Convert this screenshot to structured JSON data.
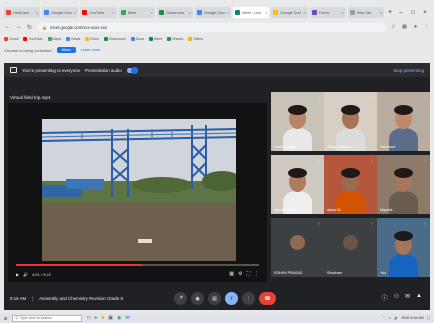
{
  "browser": {
    "tabs": [
      {
        "label": "Hindi test",
        "color": "#ea4335",
        "active": false
      },
      {
        "label": "Google Docs",
        "color": "#4285f4",
        "active": false
      },
      {
        "label": "YouTube",
        "color": "#ff0000",
        "active": false
      },
      {
        "label": "Meet",
        "color": "#34a853",
        "active": false
      },
      {
        "label": "Classroom",
        "color": "#1e8e3e",
        "active": false
      },
      {
        "label": "Google Docs",
        "color": "#4285f4",
        "active": false
      },
      {
        "label": "Meet - Live",
        "color": "#00897b",
        "active": true
      },
      {
        "label": "Google Drive",
        "color": "#fbbc04",
        "active": false
      },
      {
        "label": "Forms",
        "color": "#7248b9",
        "active": false
      },
      {
        "label": "New Tab",
        "color": "#9aa0a6",
        "active": false
      }
    ],
    "url": "meet.google.com/xxx-xxxx-xxx",
    "bookmarks": [
      {
        "label": "Gmail",
        "color": "#ea4335"
      },
      {
        "label": "YouTube",
        "color": "#ff0000"
      },
      {
        "label": "Maps",
        "color": "#34a853"
      },
      {
        "label": "News",
        "color": "#4285f4"
      },
      {
        "label": "Drive",
        "color": "#fbbc04"
      },
      {
        "label": "Classroom",
        "color": "#1e8e3e"
      },
      {
        "label": "Docs",
        "color": "#4285f4"
      },
      {
        "label": "Meet",
        "color": "#00897b"
      },
      {
        "label": "Sheets",
        "color": "#0f9d58"
      },
      {
        "label": "Slides",
        "color": "#f4b400"
      }
    ],
    "infobar": {
      "text": "Chrome is being controlled",
      "button": "Allow",
      "link": "Learn more"
    }
  },
  "meet": {
    "presenting_text": "You're presenting to everyone",
    "presentation_audio": "Presentation audio",
    "stop_presenting": "Stop presenting",
    "file_title": "Virtual field trip.mp4",
    "video_time": "4:51 / 9:22",
    "video_progress": 0.52,
    "participants": [
      {
        "name": "Harshit Singh",
        "skin": "#b88466",
        "shirt": "#e8e8e8",
        "bg": "#c9c2b8"
      },
      {
        "name": "Aditya Sharma",
        "skin": "#a97456",
        "shirt": "#dcdcdc",
        "bg": "#d7cfc4"
      },
      {
        "name": "Vaishnavi",
        "skin": "#c08a6a",
        "shirt": "#5b6b8a",
        "bg": "#b8aca0"
      },
      {
        "name": "Ayesha Ansari",
        "skin": "#b07a5c",
        "shirt": "#eeeeee",
        "bg": "#cfc9c1"
      },
      {
        "name": "Aarav M.",
        "skin": "#9c6a4e",
        "shirt": "#d35400",
        "bg": "#b5563e"
      },
      {
        "name": "Mayank",
        "skin": "#a8765a",
        "shirt": "#6a5d4f",
        "bg": "#8d7a68"
      },
      {
        "name": "ROHINI PRASAD",
        "skin": "#8e6a52",
        "shirt": "#ffffff",
        "bg": "#3c4043"
      },
      {
        "name": "Shubham",
        "skin": "#6b5444",
        "shirt": "#263238",
        "bg": "#3c4043"
      },
      {
        "name": "You",
        "skin": "#a5745a",
        "shirt": "#1565c0",
        "bg": "#4a6b8a"
      }
    ],
    "meeting_time": "9:16 AM",
    "meeting_title": "Assembly and Chemistry Revision Grade 8"
  },
  "taskbar": {
    "search_placeholder": "Type here to search",
    "tray_text": "ENG 9:16 AM"
  }
}
